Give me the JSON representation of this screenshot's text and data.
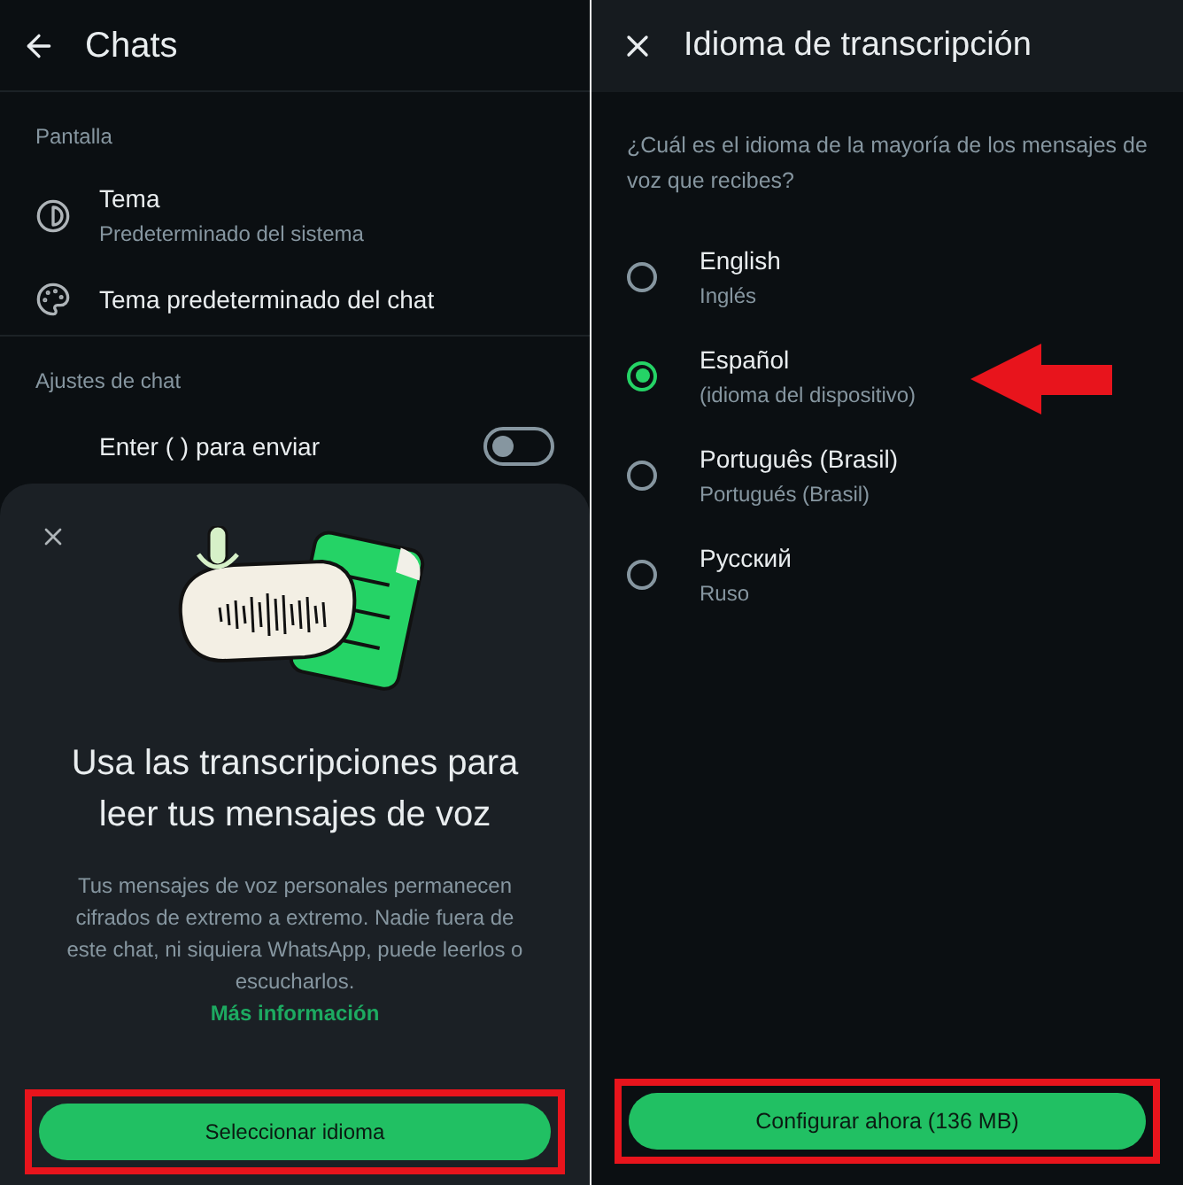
{
  "left_screen": {
    "header": {
      "title": "Chats"
    },
    "sections": [
      {
        "heading": "Pantalla",
        "items": [
          {
            "kind": "theme",
            "title": "Tema",
            "subtitle": "Predeterminado del sistema"
          },
          {
            "kind": "palette",
            "title": "Tema predeterminado del chat"
          }
        ]
      },
      {
        "heading": "Ajustes de chat",
        "items": [
          {
            "kind": "toggle",
            "title": "Enter ( ) para enviar",
            "on": false
          }
        ]
      }
    ],
    "sheet": {
      "title": "Usa las transcripciones para leer tus mensajes de voz",
      "body": "Tus mensajes de voz personales permanecen cifrados de extremo a extremo. Nadie fuera de este chat, ni siquiera WhatsApp, puede leerlos o escucharlos.",
      "link": "Más información",
      "button": "Seleccionar idioma"
    }
  },
  "right_screen": {
    "header": {
      "title": "Idioma de transcripción"
    },
    "question": "¿Cuál es el idioma de la mayoría de los mensajes de voz que recibes?",
    "options": [
      {
        "name": "English",
        "description": "Inglés",
        "selected": false
      },
      {
        "name": "Español",
        "description": "(idioma del dispositivo)",
        "selected": true
      },
      {
        "name": "Português (Brasil)",
        "description": "Portugués (Brasil)",
        "selected": false
      },
      {
        "name": "Русский",
        "description": "Ruso",
        "selected": false
      }
    ],
    "button": "Configurar ahora (136 MB)"
  }
}
